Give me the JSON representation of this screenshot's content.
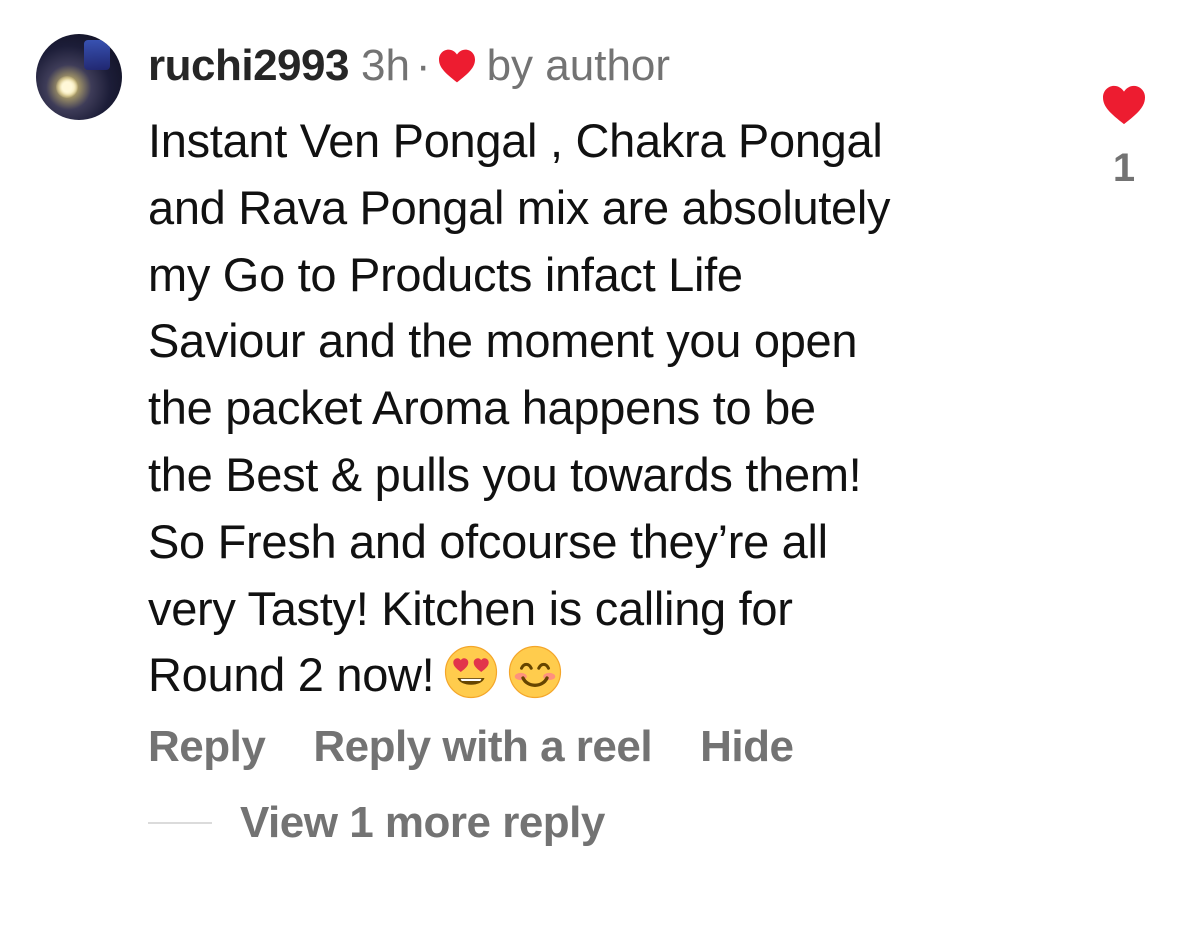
{
  "comment": {
    "username": "ruchi2993",
    "timestamp": "3h",
    "separator": "·",
    "author_like_label": "by author",
    "text_lines": [
      "Instant Ven Pongal , Chakra Pongal",
      "and Rava Pongal mix are absolutely",
      "my Go to Products infact Life",
      "Saviour and the moment you open",
      "the packet Aroma happens to be",
      "the Best & pulls you towards them!",
      "So Fresh and ofcourse they’re all",
      "very Tasty! Kitchen is calling for",
      "Round 2 now!"
    ],
    "emojis": [
      "smiling-face-with-heart-eyes",
      "smiling-face-with-smiling-eyes"
    ],
    "like_count": "1"
  },
  "actions": {
    "reply": "Reply",
    "reply_with_reel": "Reply with a reel",
    "hide": "Hide"
  },
  "view_more": {
    "label": "View 1 more reply"
  },
  "colors": {
    "heart": "#ED1C30",
    "secondary_text": "#737373",
    "primary_text": "#111111"
  }
}
